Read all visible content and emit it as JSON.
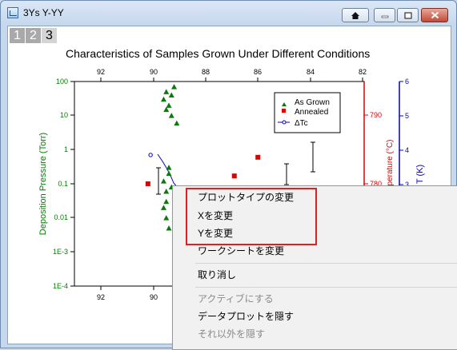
{
  "window": {
    "title": "3Ys Y-YY"
  },
  "layers": [
    "1",
    "2",
    "3"
  ],
  "chart_data": {
    "type": "scatter",
    "title": "Characteristics of Samples Grown Under Different Conditions",
    "left_axis": {
      "label": "Deposition Pressure (Torr)",
      "scale": "log",
      "ylim": [
        0.0001,
        100
      ],
      "ticks": [
        "100",
        "10",
        "1",
        "0.1",
        "0.01",
        "1E-3",
        "1E-4"
      ],
      "color": "#008000"
    },
    "right_axis_1": {
      "label": "Temperature (°C)",
      "ticks": [
        "790",
        "780"
      ],
      "color": "#e00000"
    },
    "right_axis_2": {
      "label": "T (K)",
      "ticks": [
        "6",
        "5",
        "4",
        "3"
      ],
      "color": "#0000cc"
    },
    "x_bottom_ticks": [
      "92",
      "90"
    ],
    "x_top_ticks": [
      "92",
      "90",
      "88",
      "86",
      "84",
      "82"
    ],
    "series": [
      {
        "name": "As Grown",
        "marker": "triangle",
        "color": "#0a7a0a",
        "points": [
          [
            89.5,
            50
          ],
          [
            89.2,
            70
          ],
          [
            89.6,
            30
          ],
          [
            89.3,
            40
          ],
          [
            89.4,
            20
          ],
          [
            89.5,
            15
          ],
          [
            89.1,
            6
          ],
          [
            89.3,
            10
          ],
          [
            89.4,
            0.3
          ],
          [
            89.6,
            0.12
          ],
          [
            89.4,
            0.2
          ],
          [
            89.5,
            0.06
          ],
          [
            89.3,
            0.08
          ],
          [
            89.5,
            0.03
          ],
          [
            89.6,
            0.02
          ],
          [
            89.5,
            0.01
          ],
          [
            89.4,
            0.005
          ]
        ]
      },
      {
        "name": "Annealed",
        "marker": "square",
        "color": "#e00000",
        "points": [
          [
            90.2,
            0.1
          ],
          [
            86.9,
            0.17
          ],
          [
            86.0,
            0.6
          ]
        ]
      },
      {
        "name": "ΔTc",
        "marker": "circle-open-line",
        "color": "#0000cc",
        "points": [
          [
            90.1,
            0.7
          ],
          [
            89.2,
            0.07
          ]
        ]
      }
    ]
  },
  "context_menu": {
    "items": [
      {
        "label": "プロットタイプの変更",
        "enabled": true
      },
      {
        "label": "Xを変更",
        "enabled": true
      },
      {
        "label": "Yを変更",
        "enabled": true
      },
      {
        "label": "ワークシートを変更",
        "enabled": true
      },
      {
        "label": "取り消し",
        "enabled": true
      },
      {
        "label": "アクティブにする",
        "enabled": false
      },
      {
        "label": "データプロットを隠す",
        "enabled": true
      },
      {
        "label": "それ以外を隠す",
        "enabled": false
      }
    ]
  },
  "colors": {
    "highlight": "#e02020"
  }
}
